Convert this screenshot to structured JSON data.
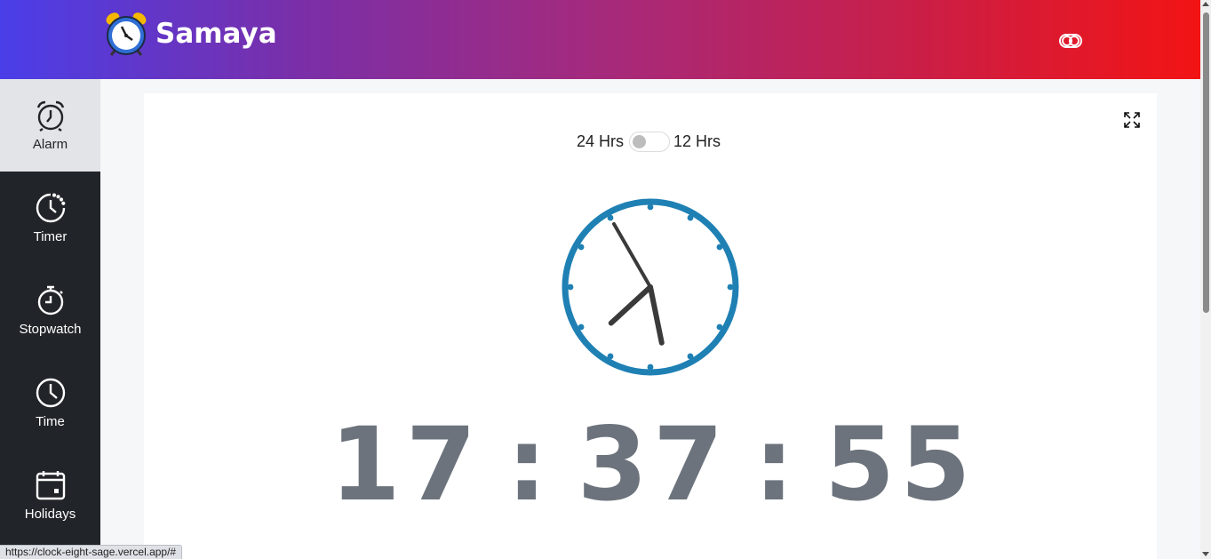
{
  "header": {
    "brand_name": "Samaya",
    "logo_icon": "alarm-clock-logo",
    "theme_toggle_icon": "toggle-theme-icon",
    "gradient_colors": [
      "#4a3ee8",
      "#f21414"
    ]
  },
  "sidebar": {
    "items": [
      {
        "label": "Alarm",
        "icon": "alarm-icon",
        "active": true
      },
      {
        "label": "Timer",
        "icon": "timer-icon",
        "active": false
      },
      {
        "label": "Stopwatch",
        "icon": "stopwatch-icon",
        "active": false
      },
      {
        "label": "Time",
        "icon": "clock-icon",
        "active": false
      },
      {
        "label": "Holidays",
        "icon": "calendar-icon",
        "active": false
      }
    ]
  },
  "main": {
    "format_toggle": {
      "left_label": "24 Hrs",
      "right_label": "12 Hrs",
      "selected": "24 Hrs"
    },
    "fullscreen_icon": "fullscreen-icon",
    "analog_clock": {
      "hours": 17,
      "minutes": 37,
      "seconds": 55,
      "accent_color": "#1f80b4",
      "hand_color": "#3a3a3a"
    },
    "digital_clock": {
      "hours": "17",
      "minutes": "37",
      "seconds": "55",
      "separator": ":"
    }
  },
  "status_bar": {
    "url": "https://clock-eight-sage.vercel.app/#"
  }
}
